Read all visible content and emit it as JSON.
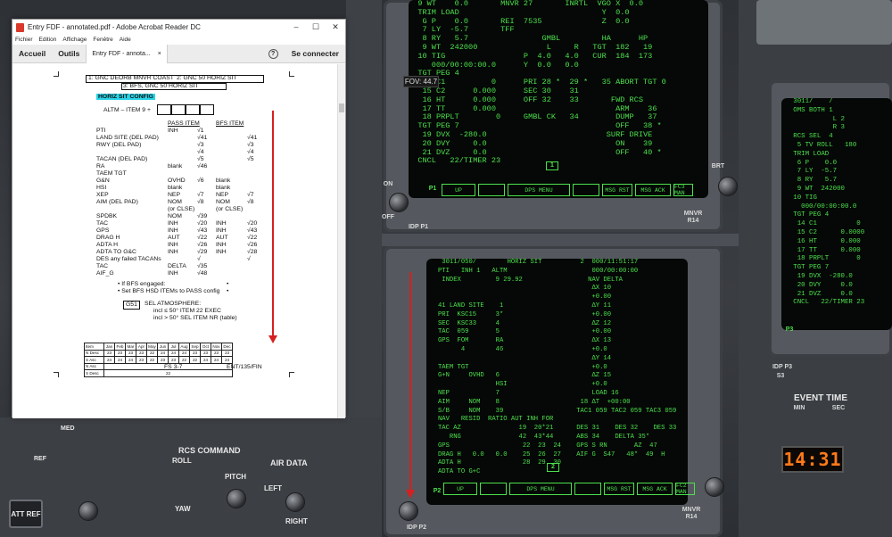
{
  "window": {
    "title": "Entry FDF - annotated.pdf - Adobe Acrobat Reader DC",
    "controls": [
      "–",
      "☐",
      "✕"
    ]
  },
  "menubar": [
    "Fichier",
    "Edition",
    "Affichage",
    "Fenêtre",
    "Aide"
  ],
  "toolbar": {
    "home": "Accueil",
    "tools": "Outils",
    "doc_tab": "Entry FDF - annota...",
    "close_tab": "×",
    "help": "?",
    "signin": "Se connecter"
  },
  "document": {
    "row1a": "1:  GNC DEORB MNVR COAST",
    "row1b": "2:  GNC 50 HORIZ SIT",
    "row2": "3:  BFS, GNC 50 HORIZ SIT",
    "section": "HORIZ  SIT  CONFIG",
    "altm": "ALTM – ITEM 9  +",
    "col_pass": "PASS ITEM",
    "col_bfs": "BFS ITEM",
    "rows": [
      {
        "l": "PTI",
        "a": "INH",
        "b": "√1",
        "c": "",
        "d": ""
      },
      {
        "l": "LAND SITE (DEL PAD)",
        "a": "",
        "b": "√41",
        "c": "",
        "d": "√41"
      },
      {
        "l": "RWY (DEL PAD)",
        "a": "",
        "b": "√3",
        "c": "",
        "d": "√3"
      },
      {
        "l": "",
        "a": "",
        "b": "√4",
        "c": "",
        "d": "√4"
      },
      {
        "l": "TACAN (DEL PAD)",
        "a": "",
        "b": "√5",
        "c": "",
        "d": "√5"
      },
      {
        "l": "RA",
        "a": "blank",
        "b": "√46",
        "c": "",
        "d": ""
      },
      {
        "l": "TAEM TGT",
        "a": "",
        "b": "",
        "c": "",
        "d": ""
      },
      {
        "l": "  G&N",
        "a": "OVHD",
        "b": "√6",
        "c": "blank",
        "d": ""
      },
      {
        "l": "  HSI",
        "a": "blank",
        "b": "",
        "c": "blank",
        "d": ""
      },
      {
        "l": "  XEP",
        "a": "NEP",
        "b": "√7",
        "c": "NEP",
        "d": "√7"
      },
      {
        "l": "  AIM (DEL PAD)",
        "a": "NOM",
        "b": "√8",
        "c": "NOM",
        "d": "√8"
      },
      {
        "l": "",
        "a": "(or CLSE)",
        "b": "",
        "c": "(or CLSE)",
        "d": ""
      },
      {
        "l": "  SPDBK",
        "a": "NOM",
        "b": "√39",
        "c": "",
        "d": ""
      },
      {
        "l": "TAC",
        "a": "INH",
        "b": "√20",
        "c": "INH",
        "d": "√20"
      },
      {
        "l": "GPS",
        "a": "INH",
        "b": "√43",
        "c": "INH",
        "d": "√43"
      },
      {
        "l": "DRAG H",
        "a": "AUT",
        "b": "√22",
        "c": "AUT",
        "d": "√22"
      },
      {
        "l": "ADTA H",
        "a": "INH",
        "b": "√26",
        "c": "INH",
        "d": "√26"
      },
      {
        "l": "ADTA TO G&C",
        "a": "INH",
        "b": "√29",
        "c": "INH",
        "d": "√28"
      },
      {
        "l": "DES any failed TACANs",
        "a": "",
        "b": "√",
        "c": "",
        "d": "√"
      },
      {
        "l": "TAC",
        "a": "DELTA",
        "b": "√35",
        "c": "",
        "d": ""
      },
      {
        "l": "AIF_G",
        "a": "INH",
        "b": "√48",
        "c": "",
        "d": ""
      }
    ],
    "bullet1": "•  If BFS engaged:",
    "bullet2": "•  Set BFS HSD ITEMs to PASS config",
    "g51": "G51",
    "sel_atm": "SEL ATMOSPHERE:",
    "incl1": "incl ≤ 50° ITEM 22 EXEC",
    "incl2": "incl > 50° SEL ITEM NR (table)",
    "months": [
      "Item",
      "Jan",
      "Feb",
      "Mar",
      "Apr",
      "May",
      "Jun",
      "Jul",
      "Aug",
      "Sep",
      "Oct",
      "Nov",
      "Dec"
    ],
    "tbl_rows": [
      {
        "h": "N Desc",
        "v": [
          "23",
          "23",
          "23",
          "23",
          "22",
          "24",
          "24",
          "24",
          "23",
          "23",
          "23",
          "23"
        ]
      },
      {
        "h": "S Asc",
        "v": [
          "24",
          "24",
          "24",
          "23",
          "22",
          "23",
          "23",
          "22",
          "22",
          "24",
          "24",
          "24"
        ]
      },
      {
        "h": "N Asc",
        "v": []
      },
      {
        "h": "S Desc",
        "v": [
          "22"
        ]
      }
    ],
    "footer_center": "FS 3-7",
    "footer_right": "ENT/135/FIN"
  },
  "cockpit": {
    "fov": "FOV: 44.7",
    "crt_top": [
      "  9 WT    0.0       MNVR 27       INRTL  VGO X  0.0",
      "  TRIM LOAD                               Y  0.0",
      "   G P    0.0       REI  7535             Z  0.0",
      "   7 LY  -5.7       TFF",
      "   8 RY   5.7                GMBL         HA      HP",
      "   9 WT  242000               L     R   TGT  182   19",
      "  10 TIG                 P  4.0   4.0   CUR  184  173",
      "     000/00:00:00.0      Y  0.0   0.0",
      "  TGT PEG 4",
      "   14 C1          0      PRI 28 *  29 *   35 ABORT TGT 0",
      "   15 C2      0.000      SEC 30    31",
      "   16 HT      0.000      OFF 32    33       FWD RCS",
      "   17 TT      0.000                          ARM    36",
      "   18 PRPLT        0     GMBL CK   34        DUMP   37",
      "  TGT PEG 7                                  OFF   38 *",
      "   19 DVX  -280.0                          SURF DRIVE",
      "   20 DVY     0.0                            ON    39",
      "   21 DVZ     0.0                            OFF   40 *",
      "  CNCL   22/TIMER 23"
    ],
    "crt_top_page": "1",
    "crt_main": [
      "    3011/050/        HORIZ SIT          2  000/11:51:17",
      "   PTI   INH 1   ALTM                      000/00:00:00",
      "    INDEX         9 29.92                 NAV DELTA",
      "                                           ΔX 10",
      "                                           +0.00",
      "   41 LAND SITE    1                       ΔY 11",
      "   PRI  KSC15     3*                       +0.00",
      "   SEC  KSC33     4                        ΔZ 12",
      "   TAC  059       5                        +0.00",
      "   GPS  FOM       RA                       ΔX 13",
      "         4        46                       +0.0",
      "                                           ΔY 14",
      "   TAEM TGT                                +0.0",
      "   G+N     OVHD   6                        ΔZ 15",
      "                  HSI                      +0.0",
      "   NEP            7                        LOAD 16",
      "   AIM     NOM    8                     18 ΔT  +00:00",
      "   S/B     NOM    39                   TAC1 059 TAC2 059 TAC3 059",
      "   NAV   RESID  RATIO AUT INH FOR",
      "   TAC AZ               19  20*21      DES 31    DES 32    DES 33",
      "      RNG               42  43*44      ABS 34    DELTA 35*",
      "   GPS                   22  23  24    GPS S RN       AZ  47",
      "   DRAG H   0.0   0.0    25  26  27    AIF G  S47   48*  49  H",
      "   ADTA H                28  29  30",
      "   ADTA TO G+C"
    ],
    "crt_main_page": "2",
    "crt_right": [
      "   3011/    /",
      "   OMS BOTH 1",
      "             L 2",
      "             R 3",
      "   RCS SEL  4",
      "    5 TV ROLL   180",
      "   TRIM LOAD",
      "    6 P    0.0",
      "    7 LY  -5.7",
      "    8 RY   5.7",
      "    9 WT  242000",
      "   10 TIG",
      "     000/00:00:00.0",
      "   TGT PEG 4",
      "    14 C1          0",
      "    15 C2      0.0000",
      "    16 HT      0.000",
      "    17 TT      0.000",
      "    18 PRPLT       0",
      "   TGT PEG 7",
      "    19 DVX  -280.0",
      "    20 DVY     0.0",
      "    21 DVZ     0.0",
      "   CNCL   22/TIMER 23"
    ],
    "fkeys_top": [
      "UP",
      "",
      "DPS MENU",
      "",
      "MSG RST",
      "MSG ACK",
      "FC3 MAN"
    ],
    "fkeys_main": [
      "UP",
      "",
      "DPS MENU",
      "",
      "MSG RST",
      "MSG ACK",
      "FC2 MAN"
    ],
    "labels": {
      "rcs_command": "RCS COMMAND",
      "roll": "ROLL",
      "pitch": "PITCH",
      "yaw": "YAW",
      "air_data": "AIR DATA",
      "left": "LEFT",
      "right": "RIGHT",
      "att_ref": "ATT REF",
      "ref": "REF",
      "med": "MED",
      "event_time": "EVENT TIME",
      "min": "MIN",
      "sec": "SEC",
      "on": "ON",
      "off": "OFF",
      "bright": "BRT",
      "mnvr_r14": "MNVR R14",
      "mnvr_r14b": "MNVR R14",
      "idp_p1": "IDP P1",
      "idp_p2": "IDP P2",
      "idp_p3": "IDP P3",
      "s3": "S3",
      "p1": "P1",
      "p2": "P2",
      "p3": "P3"
    },
    "clock": "14:31",
    "colors": {
      "crt_green": "#4de04d",
      "clock_orange": "#ff7a1a",
      "highlight_cyan": "#29d3e6",
      "annotation_red": "#d62020"
    }
  }
}
